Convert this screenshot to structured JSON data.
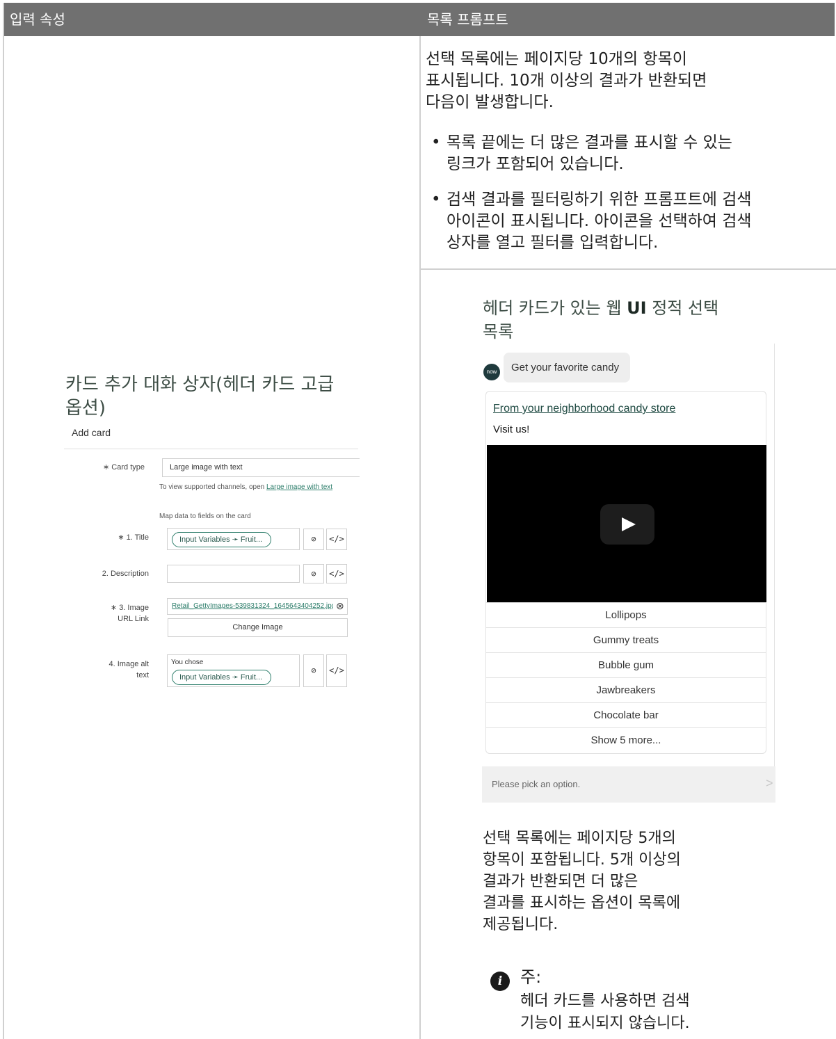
{
  "table": {
    "col_left_header": "입력 속성",
    "col_right_header": "목록 프롬프트"
  },
  "right_top": {
    "para": [
      "선택 목록에는 페이지당 10개의 항목이",
      "표시됩니다. 10개 이상의 결과가 반환되면",
      "다음이 발생합니다."
    ],
    "bullet1": [
      "목록 끝에는 더 많은 결과를 표시할 수 있는",
      "링크가 포함되어 있습니다."
    ],
    "bullet2": [
      "검색 결과를 필터링하기 위한 프롬프트에 검색",
      "아이콘이 표시됩니다. 아이콘을 선택하여 검색",
      "상자를 열고 필터를 입력합니다."
    ]
  },
  "left": {
    "caption": [
      "카드 추가 대화 상자(헤더 카드 고급",
      "옵션)"
    ],
    "dialog_title": "Add card",
    "card_type_label": "∗ Card type",
    "card_type_value": "Large image with text",
    "view_supported_prefix": "To view supported channels, open ",
    "view_supported_link": "Large image with text",
    "map_data_text": "Map data to fields on the card",
    "title_label": "∗ 1. Title",
    "title_pill": "Input Variables ➛ Fruit...",
    "description_label": "2. Description",
    "image_label_1": "∗ 3. Image",
    "image_label_2": "URL Link",
    "image_value": "Retail_GettyImages-539831324_1645643404252.jpg",
    "change_image": "Change Image",
    "alt_label_1": "4. Image alt",
    "alt_label_2": "text",
    "alt_text": "You chose",
    "alt_pill": "Input Variables ➛ Fruit...",
    "clear_icon": "⊗",
    "code_icon": "</>",
    "pick_icon": "⊘"
  },
  "right_preview": {
    "caption_prefix": "헤더 카드가 있는 웹 ",
    "caption_bold": "UI",
    "caption_suffix": " 정적 선택",
    "caption_line2": "목록",
    "avatar_text": "now",
    "bot_message": "Get your favorite candy",
    "card_link": "From your neighborhood candy store",
    "card_subtitle": "Visit us!",
    "options": [
      "Lollipops",
      "Gummy treats",
      "Bubble gum",
      "Jawbreakers",
      "Chocolate bar",
      "Show 5 more..."
    ],
    "input_placeholder": "Please pick an option.",
    "send_icon": ">"
  },
  "right_bottom": {
    "para": [
      "선택 목록에는 페이지당 5개의",
      "항목이 포함됩니다. 5개 이상의",
      "결과가 반환되면 더 많은",
      "결과를 표시하는 옵션이 목록에",
      "제공됩니다."
    ],
    "note_title": "주:",
    "note_text": [
      "헤더 카드를 사용하면 검색",
      "기능이 표시되지 않습니다."
    ],
    "note_icon": "i"
  },
  "colors": {
    "header_bg": "#707070",
    "teal": "#2c7d6a",
    "caption": "#3d4d45"
  }
}
